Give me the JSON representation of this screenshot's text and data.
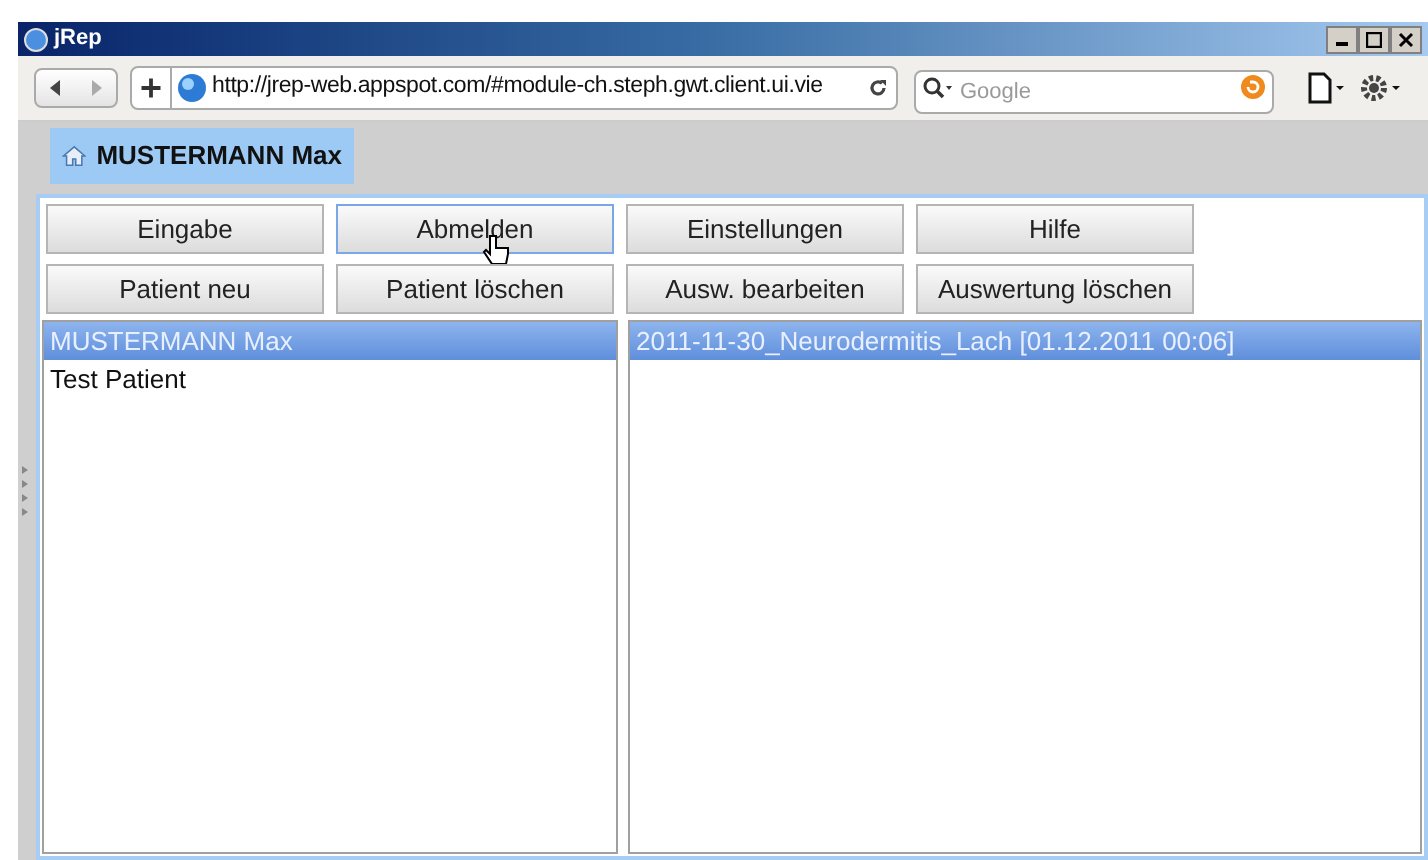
{
  "window": {
    "title": "jRep"
  },
  "browser": {
    "url": "http://jrep-web.appspot.com/#module-ch.steph.gwt.client.ui.vie",
    "search_placeholder": "Google"
  },
  "app_tab": {
    "label": "MUSTERMANN Max"
  },
  "button_rows": [
    [
      {
        "label": "Eingabe",
        "hovered": false
      },
      {
        "label": "Abmelden",
        "hovered": true
      },
      {
        "label": "Einstellungen",
        "hovered": false
      },
      {
        "label": "Hilfe",
        "hovered": false
      }
    ],
    [
      {
        "label": "Patient neu",
        "hovered": false
      },
      {
        "label": "Patient löschen",
        "hovered": false
      },
      {
        "label": "Ausw. bearbeiten",
        "hovered": false
      },
      {
        "label": "Auswertung löschen",
        "hovered": false
      }
    ]
  ],
  "patients": [
    {
      "label": "MUSTERMANN Max",
      "selected": true
    },
    {
      "label": "Test Patient",
      "selected": false
    }
  ],
  "evaluations": [
    {
      "label": "2011-11-30_Neurodermitis_Lach [01.12.2011 00:06]",
      "selected": true
    }
  ]
}
